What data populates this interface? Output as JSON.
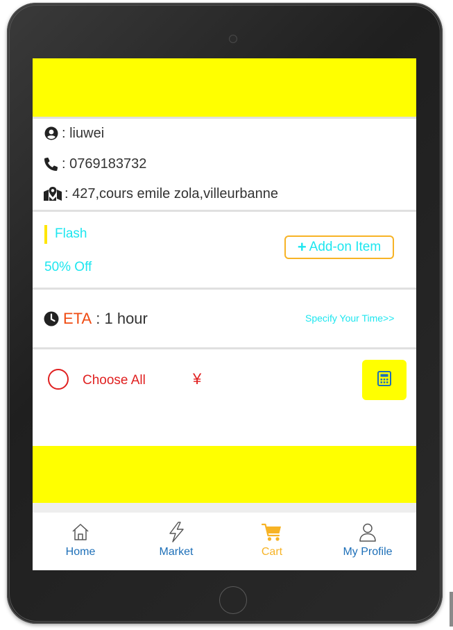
{
  "profile": {
    "name": ": liuwei",
    "phone": ": 0769183732",
    "address": ": 427,cours emile zola,villeurbanne"
  },
  "promo": {
    "flash_label": "Flash",
    "discount_label": "50% Off",
    "addon_label": "Add-on Item"
  },
  "eta": {
    "key": "ETA",
    "value": " : 1 hour",
    "specify_link": "Specify Your Time>>"
  },
  "cart": {
    "choose_all_label": "Choose All",
    "currency_symbol": "¥"
  },
  "tabs": [
    {
      "label": "Home",
      "icon": "home-icon"
    },
    {
      "label": "Market",
      "icon": "lightning-icon"
    },
    {
      "label": "Cart",
      "icon": "cart-icon",
      "active": true
    },
    {
      "label": "My Profile",
      "icon": "user-icon"
    }
  ],
  "colors": {
    "banner": "#ffff00",
    "accent_cyan": "#1de6ef",
    "accent_orange": "#f7b325",
    "eta_red": "#ef4b12",
    "choose_red": "#e02020",
    "tab_blue": "#1d6fb8"
  }
}
